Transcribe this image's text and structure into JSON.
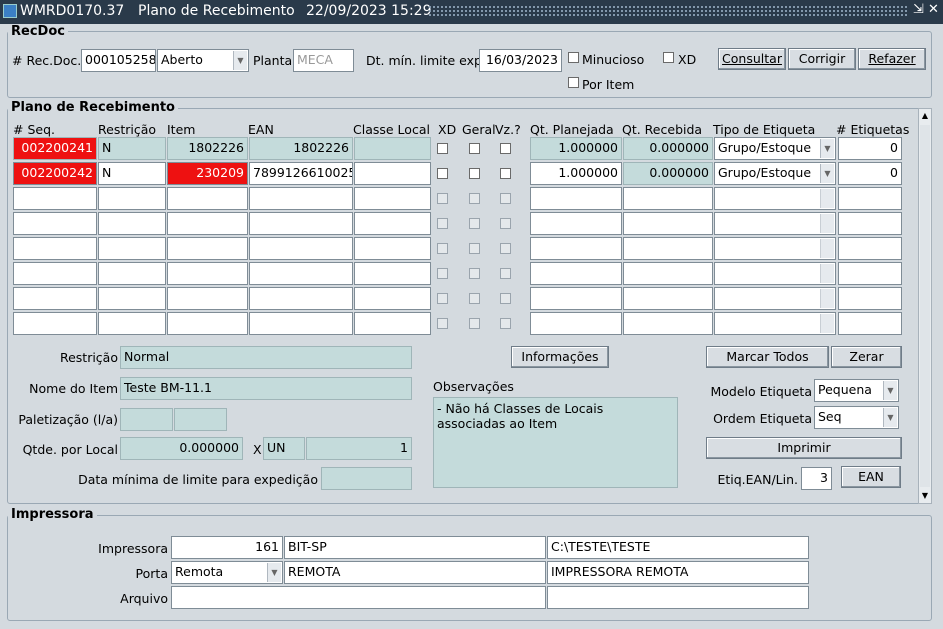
{
  "window": {
    "app_id": "WMRD0170.37",
    "title": "Plano de Recebimento",
    "datetime": "22/09/2023 15:29",
    "icon": "oracle-forms-icon"
  },
  "recdoc": {
    "section": "RecDoc",
    "rec_doc_label": "# Rec.Doc.",
    "rec_doc_value": "000105258",
    "status_value": "Aberto",
    "planta_label": "Planta",
    "planta_value": "MECA",
    "dt_label": "Dt. mín. limite exp.",
    "dt_value": "16/03/2023",
    "minucioso_label": "Minucioso",
    "xd_label": "XD",
    "por_item_label": "Por Item",
    "btn_consultar": "Consultar",
    "btn_corrigir": "Corrigir",
    "btn_refazer": "Refazer"
  },
  "plano": {
    "section": "Plano de Recebimento",
    "headers": {
      "seq": "# Seq.",
      "restricao": "Restrição",
      "item": "Item",
      "ean": "EAN",
      "classe": "Classe Local",
      "xd": "XD",
      "geral": "Geral",
      "vz": "Vz.?",
      "qt_plan": "Qt. Planejada",
      "qt_rec": "Qt. Recebida",
      "tipo": "Tipo de Etiqueta",
      "n_etiq": "# Etiquetas"
    },
    "rows": [
      {
        "seq": "002200241",
        "restricao": "N",
        "item": "1802226",
        "ean": "1802226",
        "classe": "",
        "qt_plan": "1.000000",
        "qt_rec": "0.000000",
        "tipo": "Grupo/Estoque",
        "n_etiq": "0"
      },
      {
        "seq": "002200242",
        "restricao": "N",
        "item": "230209",
        "ean": "7899126610025",
        "classe": "",
        "qt_plan": "1.000000",
        "qt_rec": "0.000000",
        "tipo": "Grupo/Estoque",
        "n_etiq": "0"
      }
    ],
    "restricao_label": "Restrição",
    "restricao_value": "Normal",
    "nome_label": "Nome do Item",
    "nome_value": "Teste BM-11.1",
    "palet_label": "Paletização (l/a)",
    "qtde_label": "Qtde. por Local",
    "qtde_value": "0.000000",
    "x_label": "X",
    "un_value": "UN",
    "qtde_units": "1",
    "data_min_label": "Data mínima de limite para expedição",
    "btn_informacoes": "Informações",
    "obs_label": "Observações",
    "obs_value": "- Não há Classes de Locais associadas ao Item",
    "btn_marcar": "Marcar Todos",
    "btn_zerar": "Zerar",
    "modelo_label": "Modelo Etiqueta",
    "modelo_value": "Pequena",
    "ordem_label": "Ordem Etiqueta",
    "ordem_value": "Seq",
    "btn_imprimir": "Imprimir",
    "etiq_lin_label": "Etiq.EAN/Lin.",
    "etiq_lin_value": "3",
    "btn_ean": "EAN"
  },
  "impressora": {
    "section": "Impressora",
    "impressora_label": "Impressora",
    "imp_num": "161",
    "imp_name": "BIT-SP",
    "imp_path": "C:\\TESTE\\TESTE",
    "porta_label": "Porta",
    "porta_value": "Remota",
    "porta_name": "REMOTA",
    "porta_desc": "IMPRESSORA REMOTA",
    "arquivo_label": "Arquivo"
  },
  "colors": {
    "highlight_red": "#ee1111",
    "readonly_teal": "#c4dbdb",
    "titlebar": "#2a3a4a"
  }
}
